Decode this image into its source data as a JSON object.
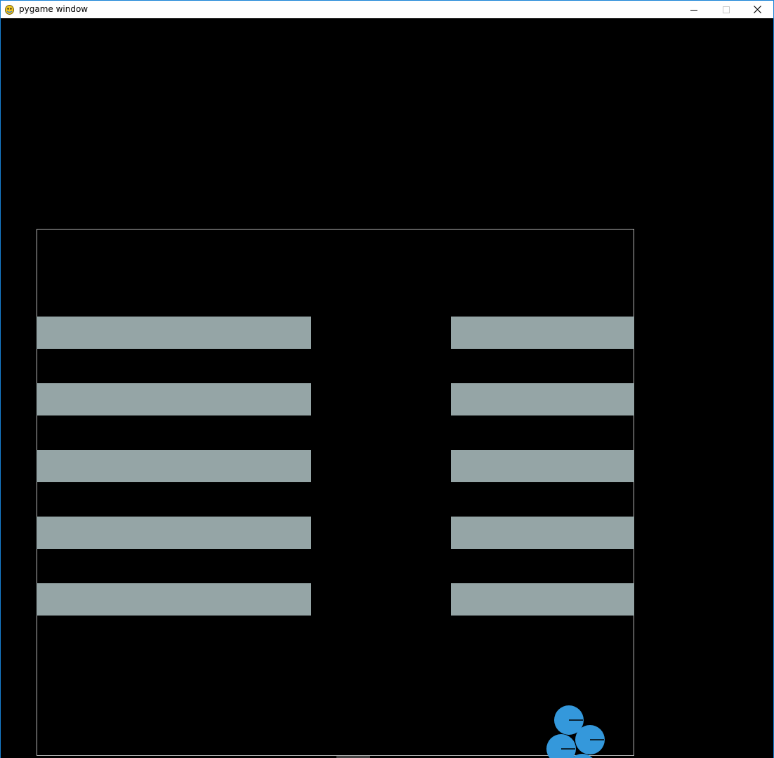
{
  "window": {
    "title": "pygame window",
    "icon": "pygame-snake-icon",
    "controls": [
      "minimize-icon",
      "maximize-icon",
      "close-icon"
    ]
  },
  "game": {
    "background_color": "#000000",
    "arena_border_color": "#b4b4b4",
    "shelf_color": "#95a5a6",
    "agent_color": "#3498db",
    "agent_heading_color": "#000000",
    "shelf_rows": 5,
    "shelf_columns": 2,
    "agent_count": 4
  }
}
